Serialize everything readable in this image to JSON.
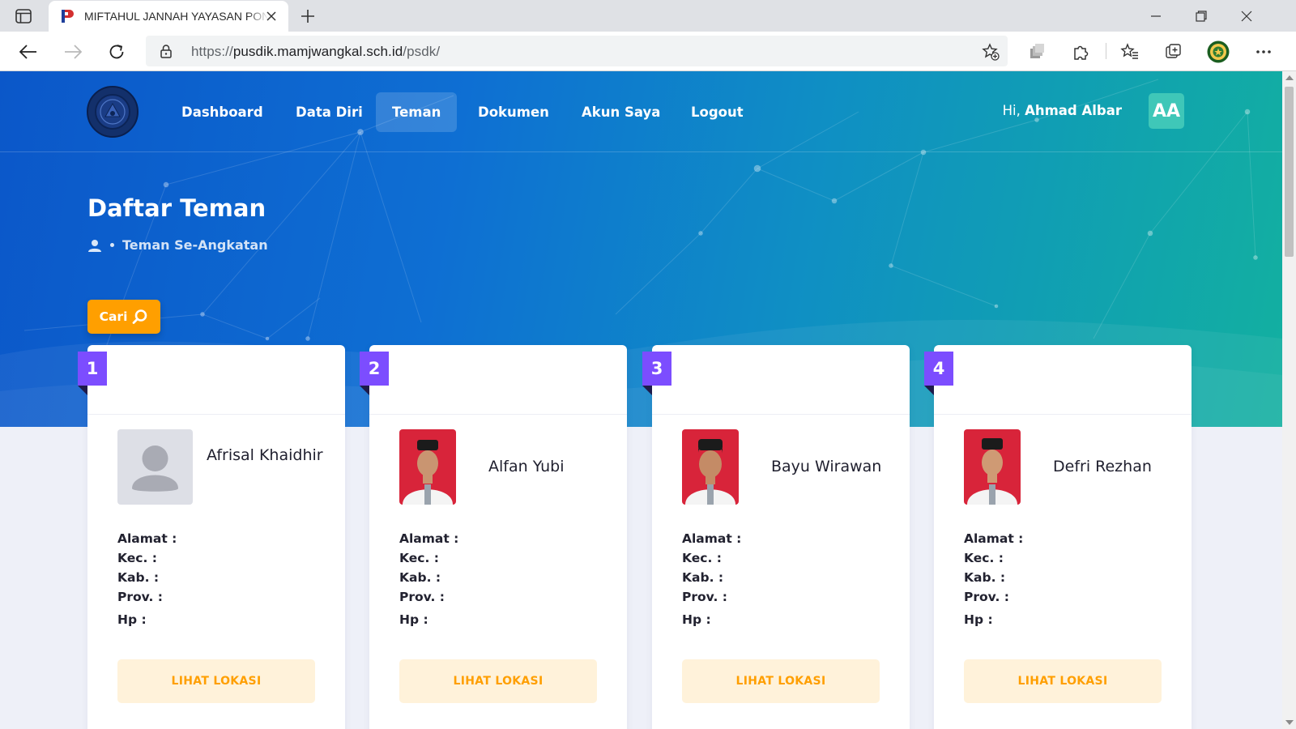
{
  "browser": {
    "tab_title": "MIFTAHUL JANNAH YAYASAN PONDOK",
    "url_scheme": "https://",
    "url_host": "pusdik.mamjwangkal.sch.id",
    "url_path": "/psdk/"
  },
  "nav": {
    "items": [
      {
        "label": "Dashboard",
        "active": false
      },
      {
        "label": "Data Diri",
        "active": false
      },
      {
        "label": "Teman",
        "active": true
      },
      {
        "label": "Dokumen",
        "active": false
      },
      {
        "label": "Akun Saya",
        "active": false
      },
      {
        "label": "Logout",
        "active": false
      }
    ],
    "greeting_prefix": "Hi,",
    "user_name": "Ahmad Albar",
    "user_initials": "AA"
  },
  "page": {
    "title": "Daftar Teman",
    "breadcrumb": "Teman Se-Angkatan",
    "search_button": "Cari"
  },
  "cards": [
    {
      "number": "1",
      "name": "Afrisal Khaidhir",
      "photo": "placeholder-avatar",
      "alamat": "Alamat :",
      "kec": "Kec. :",
      "kab": "Kab. :",
      "prov": "Prov. :",
      "hp": "Hp :",
      "button": "LIHAT LOKASI"
    },
    {
      "number": "2",
      "name": "Alfan Yubi",
      "photo": "student-photo",
      "alamat": "Alamat :",
      "kec": "Kec. :",
      "kab": "Kab. :",
      "prov": "Prov. :",
      "hp": "Hp :",
      "button": "LIHAT LOKASI"
    },
    {
      "number": "3",
      "name": "Bayu Wirawan",
      "photo": "student-photo",
      "alamat": "Alamat :",
      "kec": "Kec. :",
      "kab": "Kab. :",
      "prov": "Prov. :",
      "hp": "Hp :",
      "button": "LIHAT LOKASI"
    },
    {
      "number": "4",
      "name": "Defri Rezhan",
      "photo": "student-photo",
      "alamat": "Alamat :",
      "kec": "Kec. :",
      "kab": "Kab. :",
      "prov": "Prov. :",
      "hp": "Hp :",
      "button": "LIHAT LOKASI"
    }
  ],
  "colors": {
    "accent_orange": "#ff9f00",
    "ribbon_purple": "#7c4dff",
    "avatar_teal": "#3fc7b8",
    "hero_start": "#0b57c9",
    "hero_end": "#12b0a0"
  }
}
